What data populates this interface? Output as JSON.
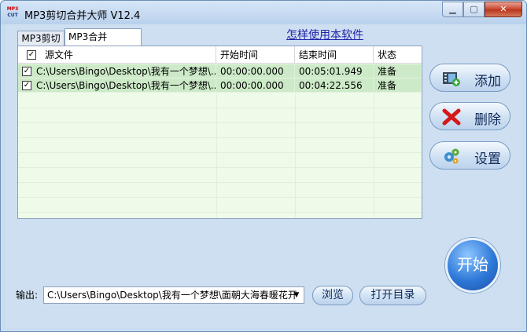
{
  "window": {
    "icon_top": "MP3",
    "icon_bottom": "CUT",
    "title": "MP3剪切合并大师 V12.4",
    "controls": {
      "minimize": "▁",
      "maximize": "▢",
      "close": "✕"
    }
  },
  "tabs": [
    {
      "label": "MP3剪切",
      "selected": false
    },
    {
      "label": "MP3合并",
      "selected": true
    }
  ],
  "help_link": "怎样使用本软件",
  "table": {
    "header_checked": "✓",
    "columns": [
      "源文件",
      "开始时间",
      "结束时间",
      "状态"
    ],
    "rows": [
      {
        "checked": "✓",
        "source": "C:\\Users\\Bingo\\Desktop\\我有一个梦想\\...",
        "start": "00:00:00.000",
        "end": "00:05:01.949",
        "status": "准备"
      },
      {
        "checked": "✓",
        "source": "C:\\Users\\Bingo\\Desktop\\我有一个梦想\\...",
        "start": "00:00:00.000",
        "end": "00:04:22.556",
        "status": "准备"
      }
    ]
  },
  "side_buttons": {
    "add": "添加",
    "delete": "删除",
    "settings": "设置"
  },
  "start_button": "开始",
  "output": {
    "label": "输出:",
    "value": "C:\\Users\\Bingo\\Desktop\\我有一个梦想\\面朝大海春暖花开",
    "arrow": "▼"
  },
  "browse_button": "浏览",
  "open_dir_button": "打开目录",
  "colors": {
    "row_selected": "#cdeac8",
    "grid_bg": "#eefbe9",
    "window_bg": "#cddff1",
    "start_blue": "#2e79d8"
  }
}
